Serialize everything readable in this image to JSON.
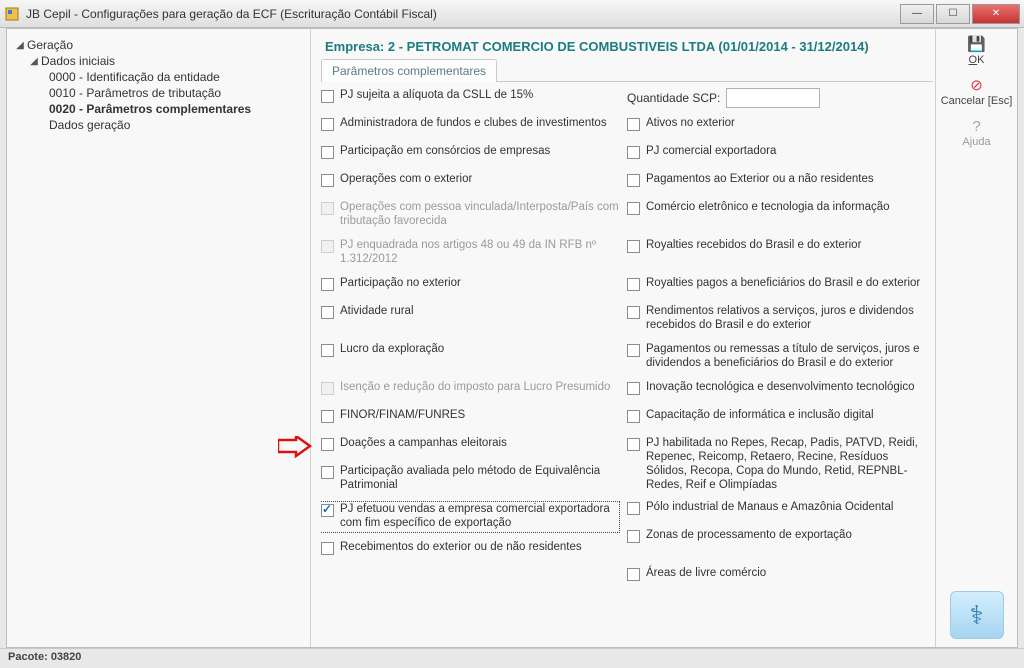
{
  "window": {
    "title": "JB Cepil - Configurações para geração da ECF (Escrituração Contábil Fiscal)"
  },
  "tree": {
    "root": "Geração",
    "dados_iniciais": "Dados iniciais",
    "n0": "0000 - Identificação da entidade",
    "n1": "0010 - Parâmetros de tributação",
    "n2": "0020 - Parâmetros complementares",
    "n3": "Dados geração"
  },
  "header": {
    "company": "Empresa: 2 - PETROMAT COMERCIO DE COMBUSTIVEIS LTDA (01/01/2014 - 31/12/2014)",
    "tab0": "Parâmetros complementares"
  },
  "left": {
    "l0": "PJ sujeita a alíquota da CSLL de 15%",
    "l1": "Administradora de fundos e clubes de investimentos",
    "l2": "Participação em consórcios de empresas",
    "l3": "Operações com o exterior",
    "l4": "Operações com pessoa vinculada/Interposta/País com tributação favorecida",
    "l5": "PJ enquadrada nos artigos 48 ou 49 da IN RFB nº 1.312/2012",
    "l6": "Participação no exterior",
    "l7": "Atividade rural",
    "l8": "Lucro da exploração",
    "l9": "Isenção e redução do imposto para Lucro Presumido",
    "l10": "FINOR/FINAM/FUNRES",
    "l11": "Doações a campanhas eleitorais",
    "l12": "Participação avaliada pelo método de Equivalência Patrimonial",
    "l13": "PJ efetuou vendas a empresa comercial exportadora com fim específico de exportação",
    "l14": "Recebimentos do exterior ou de não residentes"
  },
  "right": {
    "scp_label": "Quantidade SCP:",
    "scp_value": "",
    "r1": "Ativos no exterior",
    "r2": "PJ comercial exportadora",
    "r3": "Pagamentos ao Exterior ou a não residentes",
    "r4": "Comércio eletrônico e tecnologia da informação",
    "r5": "Royalties recebidos do Brasil e do exterior",
    "r6": "Royalties pagos a beneficiários do Brasil e do exterior",
    "r7": "Rendimentos relativos a serviços, juros e dividendos recebidos do Brasil e do exterior",
    "r8": "Pagamentos ou remessas a título de serviços, juros e dividendos a beneficiários do Brasil e do exterior",
    "r9": "Inovação tecnológica e desenvolvimento tecnológico",
    "r10": "Capacitação de informática e inclusão digital",
    "r11": "PJ habilitada no Repes, Recap, Padis, PATVD, Reidi, Repenec, Reicomp, Retaero, Recine, Resíduos Sólidos, Recopa, Copa do Mundo, Retid, REPNBL-Redes, Reif e Olimpíadas",
    "r12": "Pólo industrial de Manaus e Amazônia Ocidental",
    "r13": "Zonas de processamento de exportação",
    "r14": "Áreas de livre comércio"
  },
  "side": {
    "ok": "OK",
    "cancel": "Cancelar [Esc]",
    "help": "Ajuda"
  },
  "status": {
    "pacote_label": "Pacote:",
    "pacote_value": "03820"
  }
}
